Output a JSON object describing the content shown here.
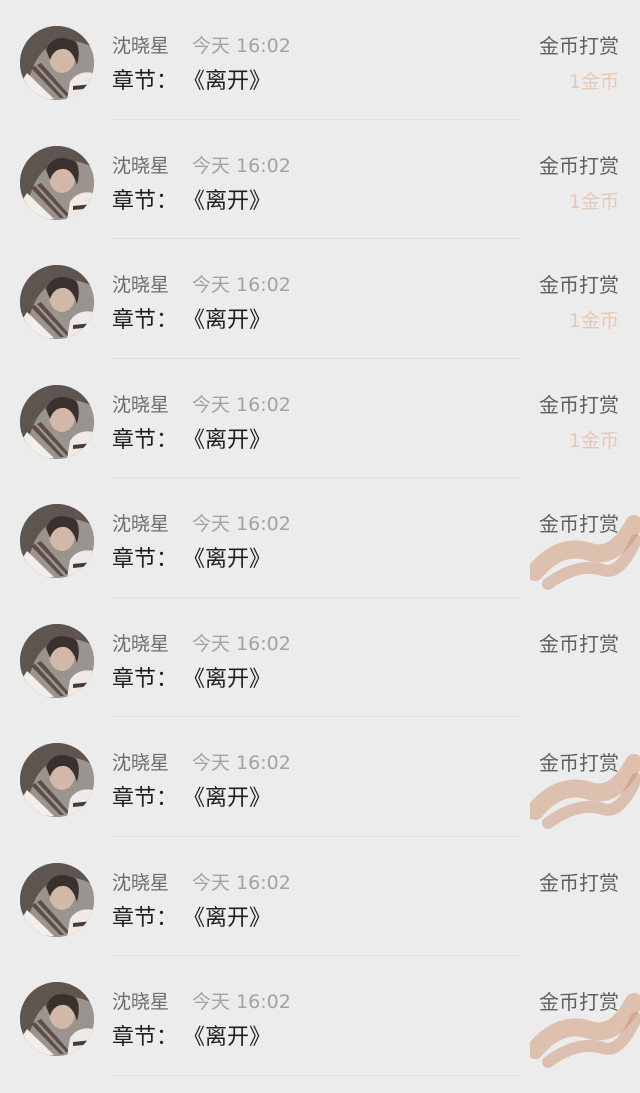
{
  "rewards": [
    {
      "user": "沈晓星",
      "time": "今天 16:02",
      "chapter_label": "章节：",
      "chapter_title": "《离开》",
      "reward_type": "金币打赏",
      "amount": "1金币",
      "smudge": false
    },
    {
      "user": "沈晓星",
      "time": "今天 16:02",
      "chapter_label": "章节：",
      "chapter_title": "《离开》",
      "reward_type": "金币打赏",
      "amount": "1金币",
      "smudge": false
    },
    {
      "user": "沈晓星",
      "time": "今天 16:02",
      "chapter_label": "章节：",
      "chapter_title": "《离开》",
      "reward_type": "金币打赏",
      "amount": "1金币",
      "smudge": false
    },
    {
      "user": "沈晓星",
      "time": "今天 16:02",
      "chapter_label": "章节：",
      "chapter_title": "《离开》",
      "reward_type": "金币打赏",
      "amount": "1金币",
      "smudge": false
    },
    {
      "user": "沈晓星",
      "time": "今天 16:02",
      "chapter_label": "章节：",
      "chapter_title": "《离开》",
      "reward_type": "金币打赏",
      "amount": "",
      "smudge": true
    },
    {
      "user": "沈晓星",
      "time": "今天 16:02",
      "chapter_label": "章节：",
      "chapter_title": "《离开》",
      "reward_type": "金币打赏",
      "amount": "",
      "smudge": false
    },
    {
      "user": "沈晓星",
      "time": "今天 16:02",
      "chapter_label": "章节：",
      "chapter_title": "《离开》",
      "reward_type": "金币打赏",
      "amount": "",
      "smudge": true
    },
    {
      "user": "沈晓星",
      "time": "今天 16:02",
      "chapter_label": "章节：",
      "chapter_title": "《离开》",
      "reward_type": "金币打赏",
      "amount": "",
      "smudge": false
    },
    {
      "user": "沈晓星",
      "time": "今天 16:02",
      "chapter_label": "章节：",
      "chapter_title": "《离开》",
      "reward_type": "金币打赏",
      "amount": "",
      "smudge": true
    }
  ],
  "colors": {
    "background": "#ececec",
    "name": "#6d6d6d",
    "time": "#a3a3a3",
    "chapter": "#1f1f1f",
    "reward_type": "#5f5f5f",
    "amount": "#d96c2f"
  },
  "icons": {
    "avatar": "user-avatar-image",
    "smudge": "scribble-mark"
  }
}
